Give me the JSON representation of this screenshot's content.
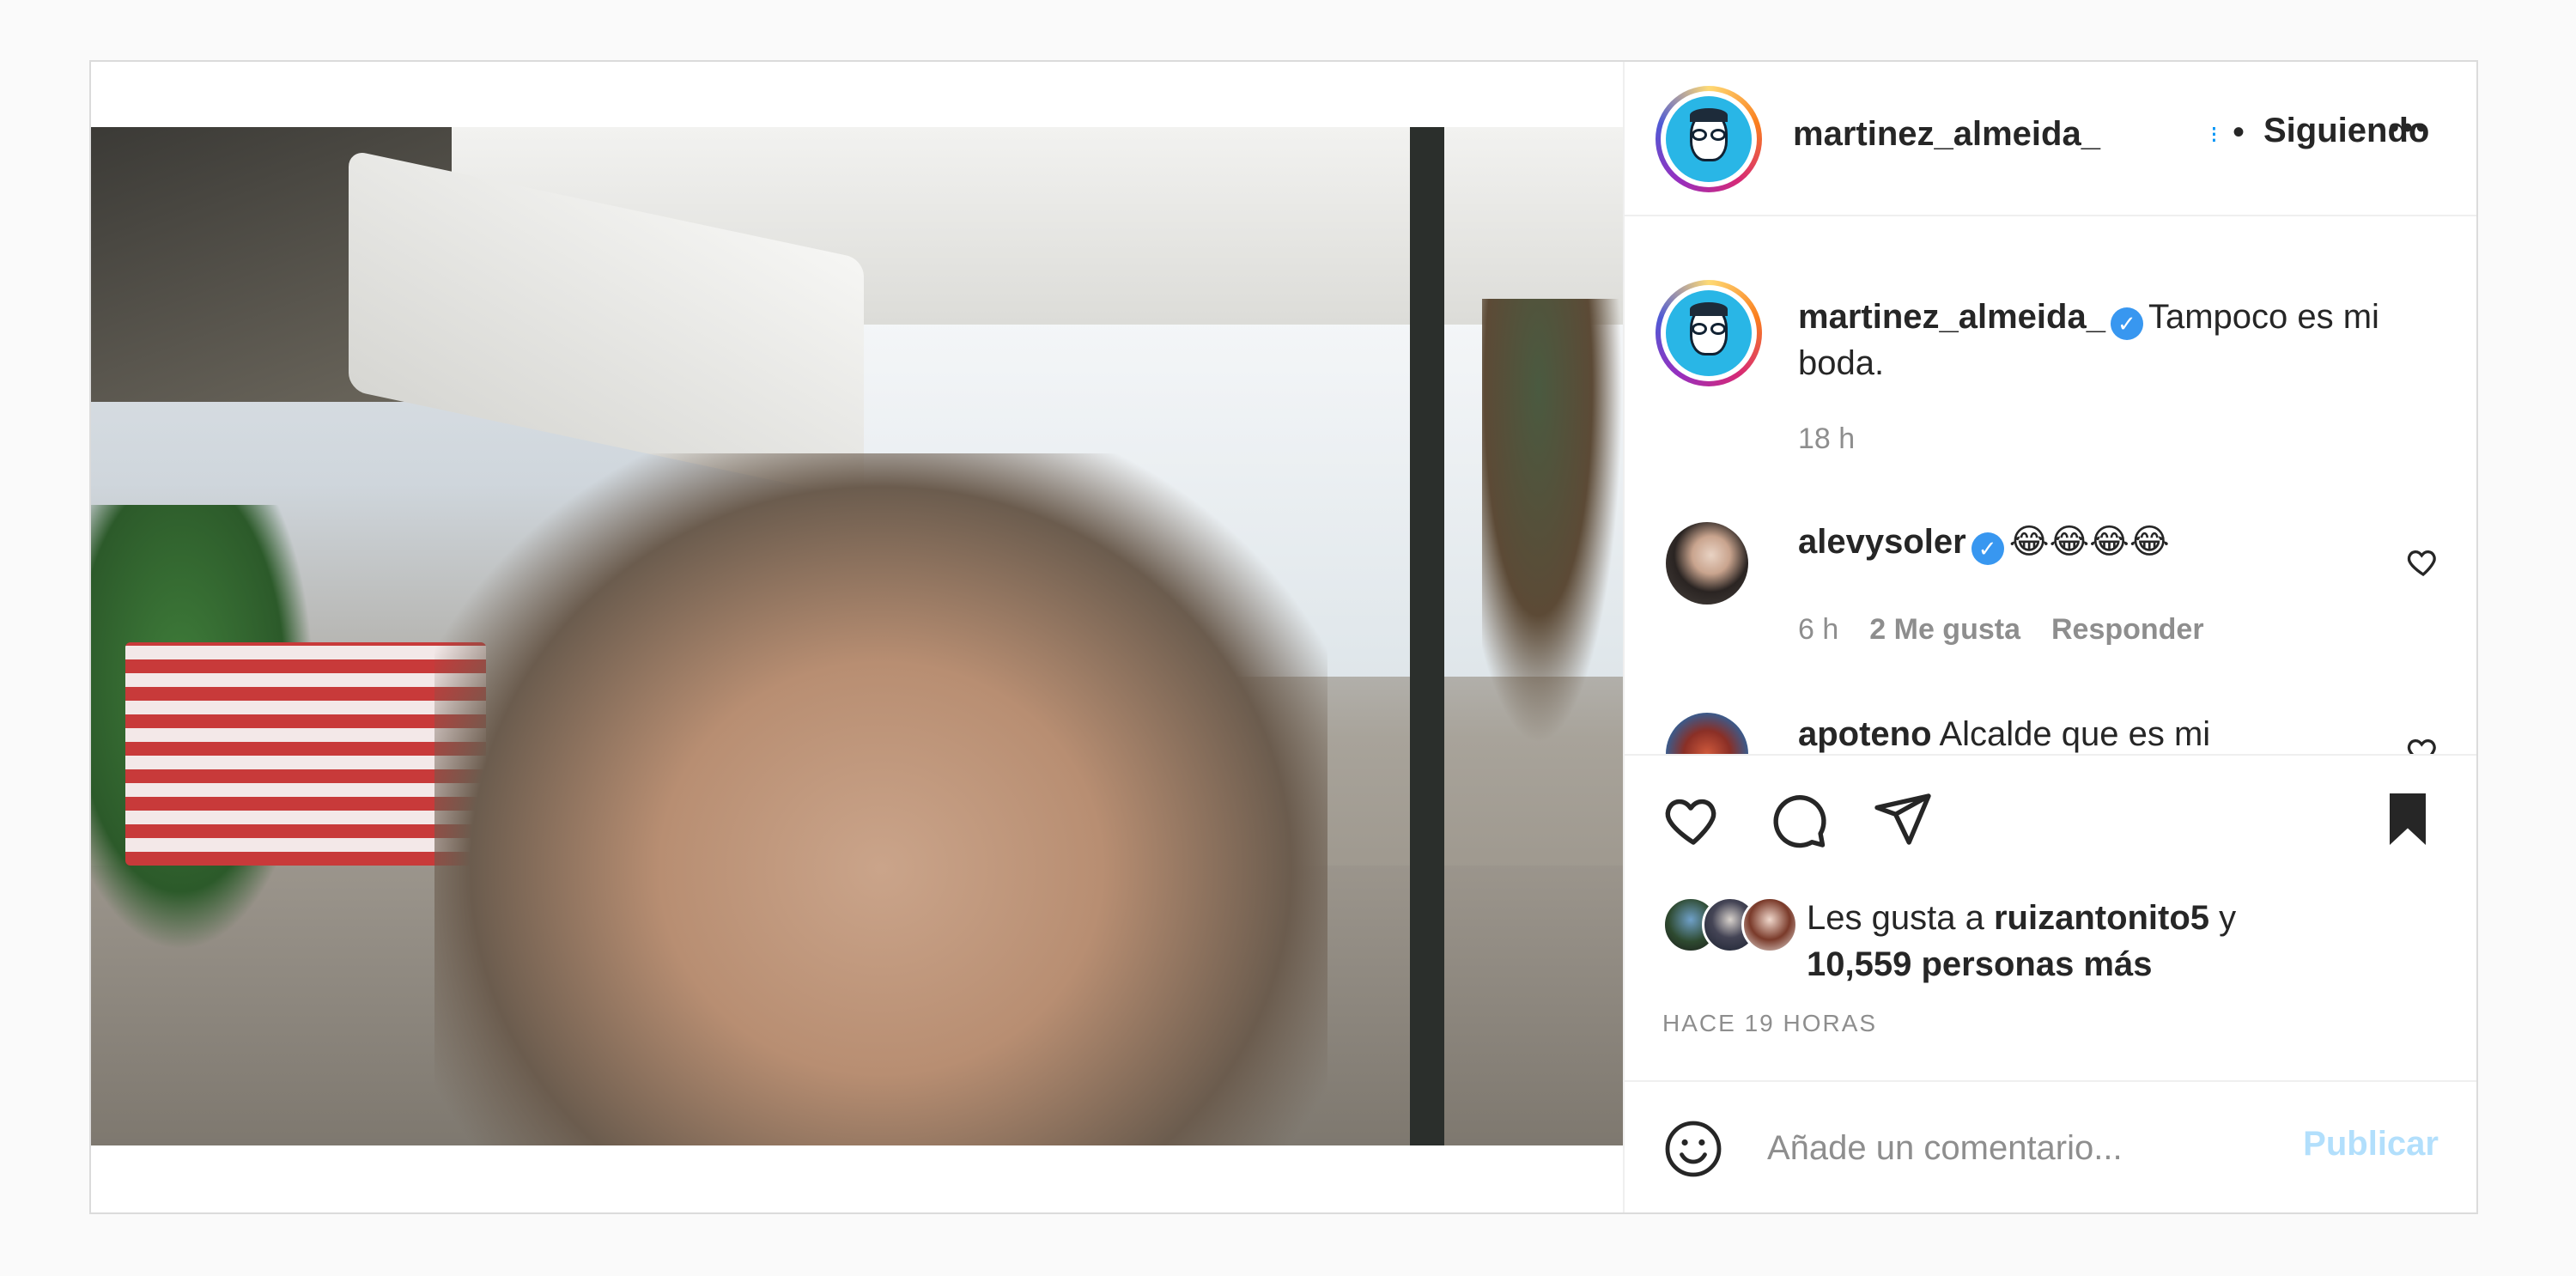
{
  "header": {
    "username": "martinez_almeida_",
    "dot_separator": "•",
    "follow_status": "Siguiendo",
    "more_label": "•••"
  },
  "caption": {
    "username": "martinez_almeida_",
    "text": "Tampoco es mi boda.",
    "time": "18 h"
  },
  "comments": [
    {
      "username": "alevysoler",
      "text": "😂😂😂😂",
      "time": "6 h",
      "likes": "2 Me gusta",
      "reply": "Responder"
    },
    {
      "username": "apoteno",
      "text": "Alcalde que es mi prometida 👊🏾"
    }
  ],
  "likes": {
    "prefix": "Les gusta a",
    "user": "ruizantonito5",
    "connector": "y",
    "others": "10,559 personas más"
  },
  "time_ago": "HACE 19 HORAS",
  "add_comment": {
    "placeholder": "Añade un comentario...",
    "publish": "Publicar"
  },
  "icons": {
    "verified": "verified-badge-icon",
    "like": "heart-icon",
    "comment": "comment-bubble-icon",
    "share": "paper-plane-icon",
    "save": "bookmark-filled-icon",
    "emoji": "emoji-smile-icon",
    "more": "more-options-icon"
  },
  "colors": {
    "link_blue": "#0095f6",
    "verified_blue": "#3897f0",
    "publish_disabled": "#b2dffc",
    "muted_text": "#8e8e8e"
  }
}
